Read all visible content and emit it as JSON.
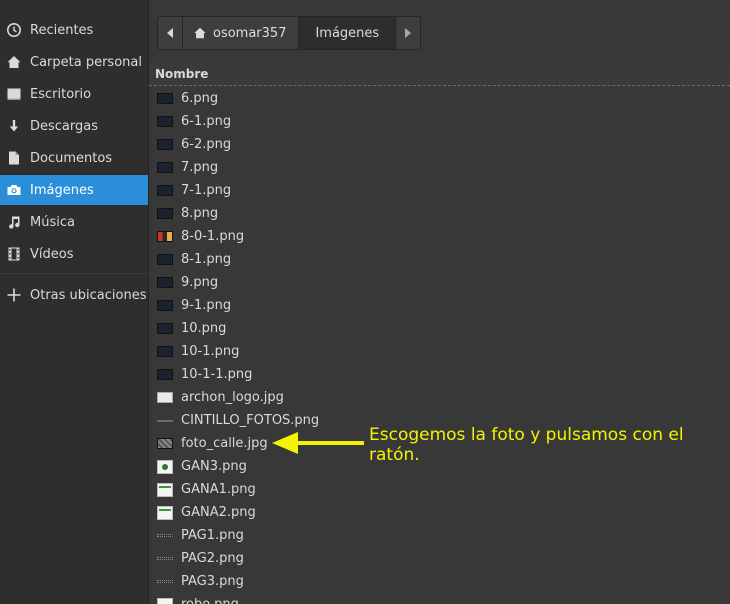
{
  "sidebar": {
    "items": [
      {
        "label": "Recientes",
        "icon": "clock-icon",
        "selected": false
      },
      {
        "label": "Carpeta personal",
        "icon": "home-icon",
        "selected": false
      },
      {
        "label": "Escritorio",
        "icon": "desktop-icon",
        "selected": false
      },
      {
        "label": "Descargas",
        "icon": "download-icon",
        "selected": false
      },
      {
        "label": "Documentos",
        "icon": "document-icon",
        "selected": false
      },
      {
        "label": "Imágenes",
        "icon": "camera-icon",
        "selected": true
      },
      {
        "label": "Música",
        "icon": "music-note-icon",
        "selected": false
      },
      {
        "label": "Vídeos",
        "icon": "film-icon",
        "selected": false
      }
    ],
    "other_locations": {
      "label": "Otras ubicaciones",
      "icon": "plus-icon"
    }
  },
  "pathbar": {
    "home": "osomar357",
    "current": "Imágenes"
  },
  "list": {
    "column_name": "Nombre",
    "files": [
      {
        "name": "6.png",
        "thumb": "dark"
      },
      {
        "name": "6-1.png",
        "thumb": "dark"
      },
      {
        "name": "6-2.png",
        "thumb": "dark"
      },
      {
        "name": "7.png",
        "thumb": "dark"
      },
      {
        "name": "7-1.png",
        "thumb": "dark"
      },
      {
        "name": "8.png",
        "thumb": "dark"
      },
      {
        "name": "8-0-1.png",
        "thumb": "flag"
      },
      {
        "name": "8-1.png",
        "thumb": "dark"
      },
      {
        "name": "9.png",
        "thumb": "dark"
      },
      {
        "name": "9-1.png",
        "thumb": "dark"
      },
      {
        "name": "10.png",
        "thumb": "dark"
      },
      {
        "name": "10-1.png",
        "thumb": "dark"
      },
      {
        "name": "10-1-1.png",
        "thumb": "dark"
      },
      {
        "name": "archon_logo.jpg",
        "thumb": "logo"
      },
      {
        "name": "CINTILLO_FOTOS.png",
        "thumb": "line"
      },
      {
        "name": "foto_calle.jpg",
        "thumb": "photo"
      },
      {
        "name": "GAN3.png",
        "thumb": "green"
      },
      {
        "name": "GANA1.png",
        "thumb": "stripe"
      },
      {
        "name": "GANA2.png",
        "thumb": "stripe"
      },
      {
        "name": "PAG1.png",
        "thumb": "pag"
      },
      {
        "name": "PAG2.png",
        "thumb": "pag"
      },
      {
        "name": "PAG3.png",
        "thumb": "pag"
      },
      {
        "name": "robo.png",
        "thumb": "white"
      }
    ]
  },
  "annotation": {
    "text": "Escogemos la foto y pulsamos con el ratón.",
    "color": "#f4f400"
  },
  "colors": {
    "accent": "#2a8fd8",
    "sidebar_bg": "#2e2e2e",
    "main_bg": "#383838"
  }
}
